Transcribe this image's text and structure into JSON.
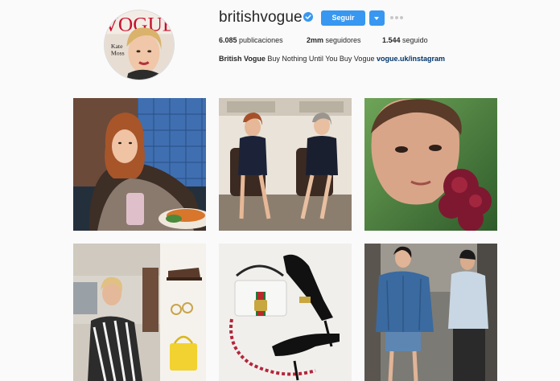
{
  "profile": {
    "username": "britishvogue",
    "verified": true,
    "follow_label": "Seguir",
    "stats": [
      {
        "count": "6.085",
        "label": "publicaciones"
      },
      {
        "count": "2mm",
        "label": "seguidores"
      },
      {
        "count": "1.544",
        "label": "seguido"
      }
    ],
    "bio_name": "British Vogue",
    "bio_text": "Buy Nothing Until You Buy Vogue",
    "bio_link": "vogue.uk/instagram"
  },
  "avatar": {
    "masthead": "VOGUE",
    "cover_name_line1": "Kate",
    "cover_name_line2": "Moss"
  },
  "icons": {
    "verified": "verified-badge-icon",
    "dropdown": "chevron-down-icon",
    "more": "more-options-icon"
  },
  "colors": {
    "accent": "#3897f0",
    "link": "#003569",
    "background": "#fafafa",
    "text": "#262626"
  },
  "posts": [
    {
      "id": "post-1"
    },
    {
      "id": "post-2"
    },
    {
      "id": "post-3"
    },
    {
      "id": "post-4"
    },
    {
      "id": "post-5"
    },
    {
      "id": "post-6"
    }
  ]
}
